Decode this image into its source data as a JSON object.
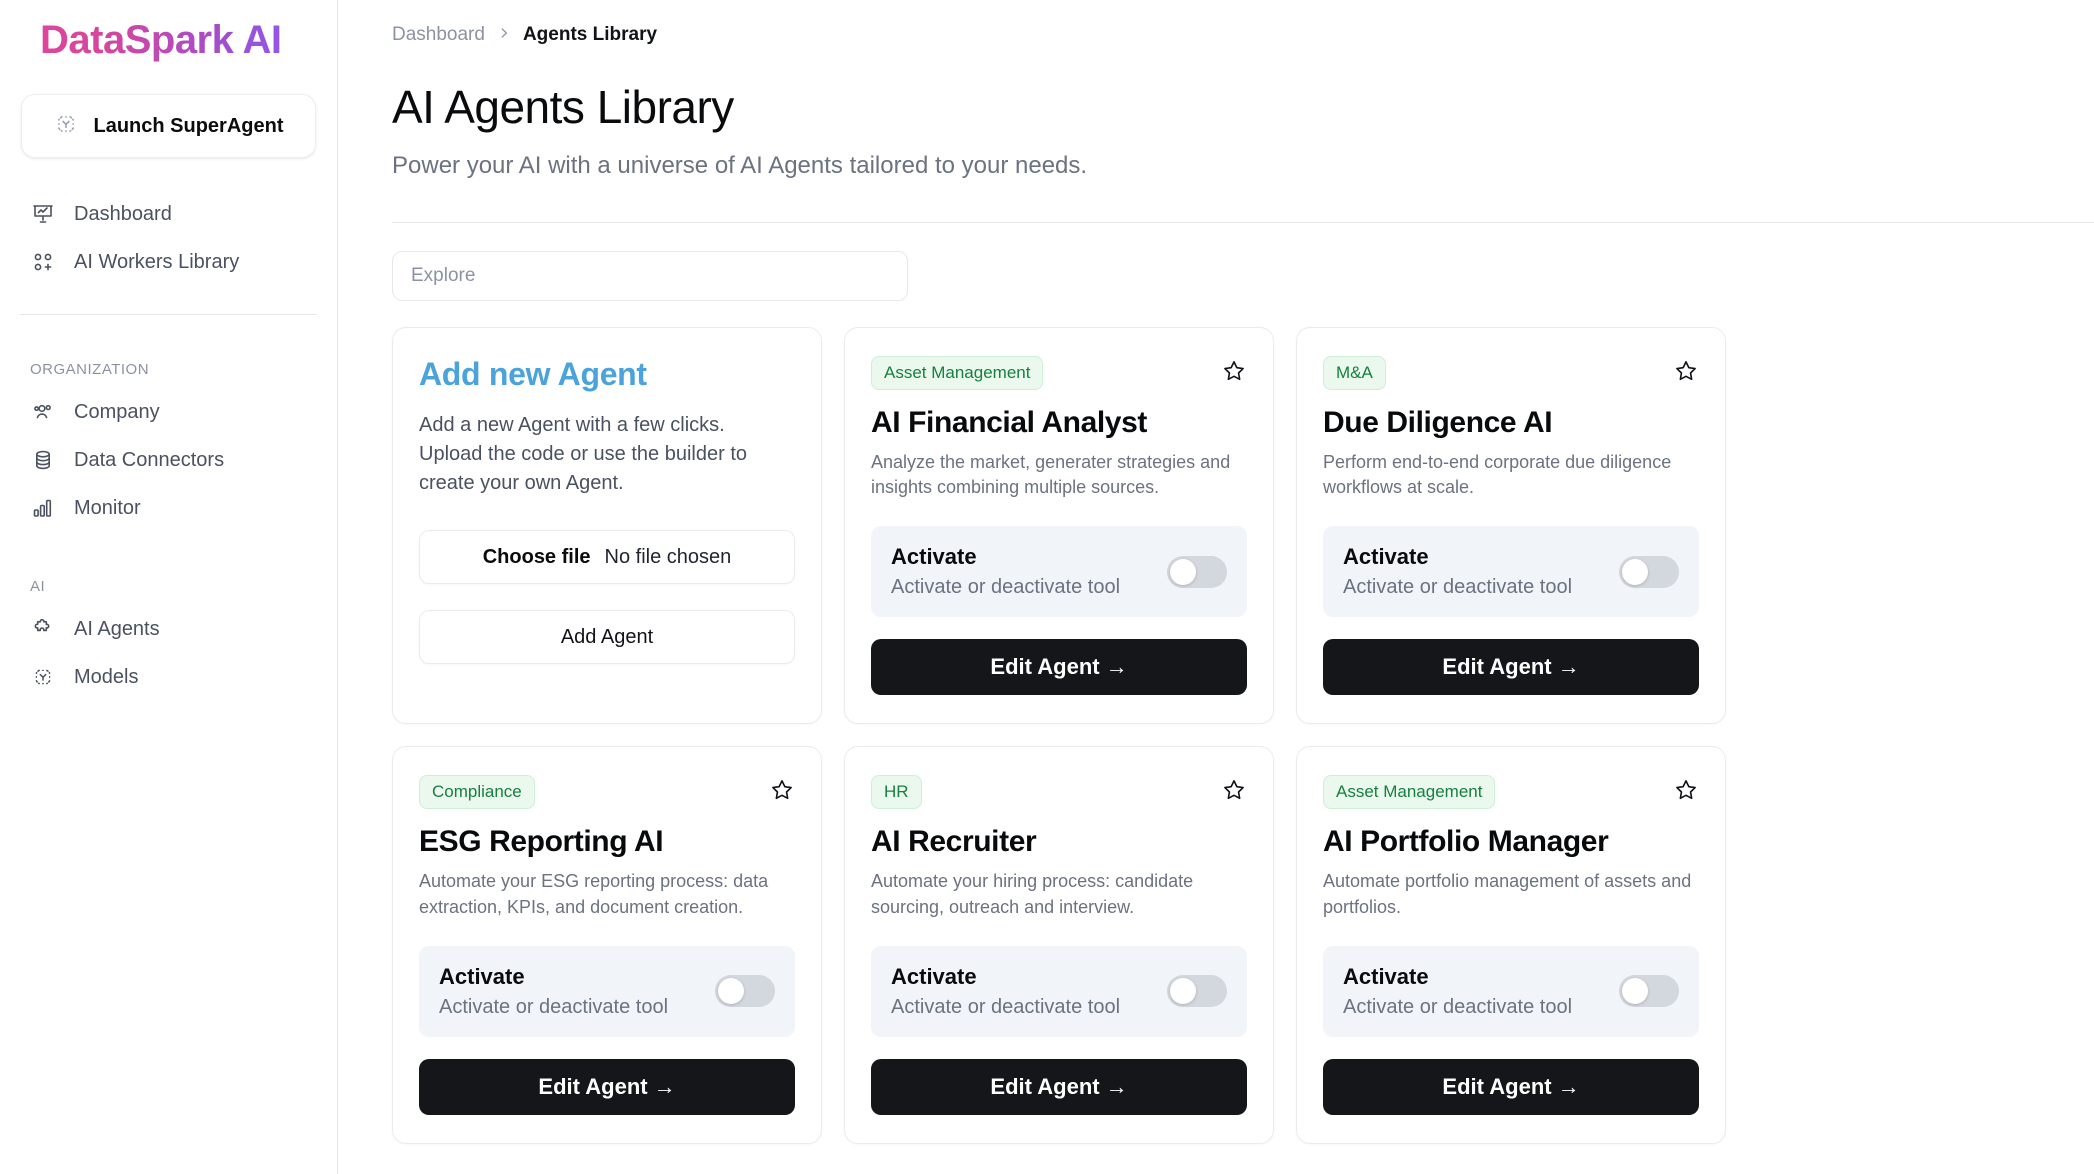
{
  "brand": {
    "name": "DataSpark AI"
  },
  "sidebar": {
    "launch": {
      "label": "Launch SuperAgent",
      "icon": "superagent-icon"
    },
    "primary_items": [
      {
        "label": "Dashboard",
        "icon": "dashboard-icon"
      },
      {
        "label": "AI Workers Library",
        "icon": "workers-grid-plus-icon"
      }
    ],
    "groups": [
      {
        "label": "ORGANIZATION",
        "items": [
          {
            "label": "Company",
            "icon": "users-icon"
          },
          {
            "label": "Data Connectors",
            "icon": "database-icon"
          },
          {
            "label": "Monitor",
            "icon": "bar-chart-icon"
          }
        ]
      },
      {
        "label": "AI",
        "items": [
          {
            "label": "AI Agents",
            "icon": "puzzle-icon"
          },
          {
            "label": "Models",
            "icon": "models-icon"
          }
        ]
      }
    ]
  },
  "breadcrumb": {
    "root": "Dashboard",
    "separator": "›",
    "current": "Agents Library"
  },
  "header": {
    "title": "AI Agents Library",
    "subtitle": "Power your AI with a universe of AI Agents tailored to your needs."
  },
  "search": {
    "placeholder": "Explore",
    "value": ""
  },
  "add_card": {
    "title": "Add new Agent",
    "description": "Add a new Agent with a few clicks. Upload the code or use the builder to create your own Agent.",
    "choose_file_label": "Choose file",
    "file_status": "No file chosen",
    "submit_label": "Add Agent"
  },
  "common": {
    "activate_title": "Activate",
    "activate_subtitle": "Activate or deactivate tool",
    "edit_label": "Edit Agent",
    "edit_arrow": "→"
  },
  "agents": [
    {
      "badge": "Asset Management",
      "name": "AI Financial Analyst",
      "description": "Analyze the market, generater strategies and insights combining multiple sources.",
      "activated": false,
      "favorite": false
    },
    {
      "badge": "M&A",
      "name": "Due Diligence AI",
      "description": "Perform end-to-end corporate due diligence workflows at scale.",
      "activated": false,
      "favorite": false
    },
    {
      "badge": "Compliance",
      "name": "ESG Reporting AI",
      "description": "Automate your ESG reporting process: data extraction, KPIs, and document creation.",
      "activated": false,
      "favorite": false
    },
    {
      "badge": "HR",
      "name": "AI Recruiter",
      "description": "Automate your hiring process: candidate sourcing, outreach and interview.",
      "activated": false,
      "favorite": false
    },
    {
      "badge": "Asset Management",
      "name": "AI Portfolio Manager",
      "description": "Automate portfolio management of assets and portfolios.",
      "activated": false,
      "favorite": false
    }
  ],
  "colors": {
    "brand_gradient_start": "#e0459a",
    "brand_gradient_end": "#8b5cf6",
    "accent_blue": "#4ba3dc",
    "badge_bg": "#eaf8ee",
    "badge_text": "#17803d",
    "panel_bg": "#f1f4f9",
    "button_dark": "#141619"
  }
}
